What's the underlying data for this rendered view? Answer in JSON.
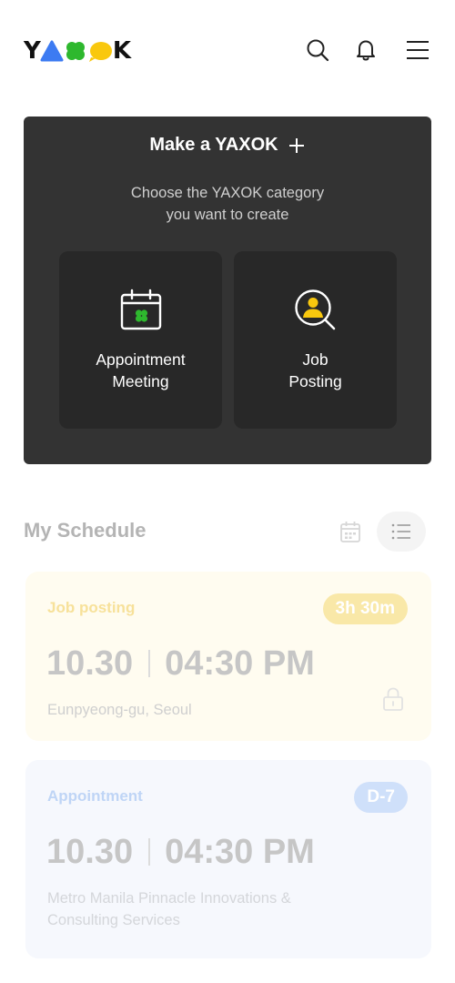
{
  "header": {
    "logo_text": "YAXOK",
    "logo_letters": [
      "Y",
      "K"
    ],
    "icons": [
      "search-icon",
      "bell-icon",
      "menu-icon"
    ]
  },
  "create": {
    "title": "Make a YAXOK",
    "subtitle_line1": "Choose the YAXOK category",
    "subtitle_line2": "you want to create",
    "options": [
      {
        "line1": "Appointment",
        "line2": "Meeting",
        "icon": "calendar-clover-icon"
      },
      {
        "line1": "Job",
        "line2": "Posting",
        "icon": "search-person-icon"
      }
    ]
  },
  "schedule": {
    "title": "My Schedule",
    "cards": [
      {
        "category": "Job posting",
        "badge": "3h 30m",
        "date": "10.30",
        "time": "04:30 PM",
        "location_line1": "Eunpyeong-gu, Seoul",
        "location_line2": ""
      },
      {
        "category": "Appointment",
        "badge": "D-7",
        "date": "10.30",
        "time": "04:30 PM",
        "location_line1": "Metro Manila Pinnacle Innovations &",
        "location_line2": "Consulting Services"
      }
    ]
  },
  "colors": {
    "card_dark": "#333333",
    "option_dark": "#282828",
    "job_accent": "#f7d34a",
    "appointment_accent": "#a9c8f5",
    "clover_green": "#2eb82e",
    "logo_blue": "#3d7bf2",
    "logo_yellow": "#f9c80e"
  }
}
